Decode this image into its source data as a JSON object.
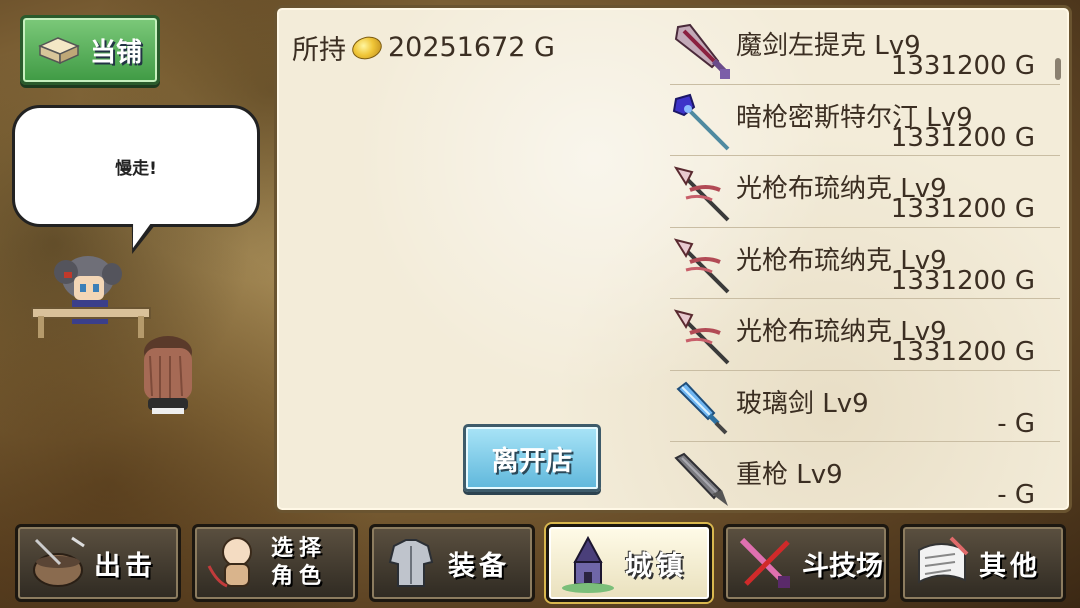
{
  "shop_tag": {
    "label": "当铺",
    "icon": "box-icon"
  },
  "speech": {
    "text": "慢走!"
  },
  "panel": {
    "holdings_label": "所持",
    "gold_amount": "20251672 G",
    "leave_label": "离开店"
  },
  "items": [
    {
      "name": "魔剑左提克 Lv9",
      "price": "1331200 G",
      "icon": "demon-sword-icon"
    },
    {
      "name": "暗枪密斯特尔汀 Lv9",
      "price": "1331200 G",
      "icon": "dark-spear-icon"
    },
    {
      "name": "光枪布琉纳克 Lv9",
      "price": "1331200 G",
      "icon": "light-spear-icon"
    },
    {
      "name": "光枪布琉纳克 Lv9",
      "price": "1331200 G",
      "icon": "light-spear-icon"
    },
    {
      "name": "光枪布琉纳克 Lv9",
      "price": "1331200 G",
      "icon": "light-spear-icon"
    },
    {
      "name": "玻璃剑 Lv9",
      "price": "- G",
      "icon": "glass-sword-icon"
    },
    {
      "name": "重枪 Lv9",
      "price": "- G",
      "icon": "heavy-lance-icon"
    }
  ],
  "nav": [
    {
      "label": "出击",
      "icon": "pot-icon"
    },
    {
      "label": "选择角色",
      "line1": "选择",
      "line2": "角色",
      "icon": "character-icon"
    },
    {
      "label": "装备",
      "icon": "armor-icon"
    },
    {
      "label": "城镇",
      "icon": "town-icon",
      "active": true
    },
    {
      "label": "斗技场",
      "icon": "crossed-swords-icon"
    },
    {
      "label": "其他",
      "icon": "scroll-icon"
    }
  ]
}
